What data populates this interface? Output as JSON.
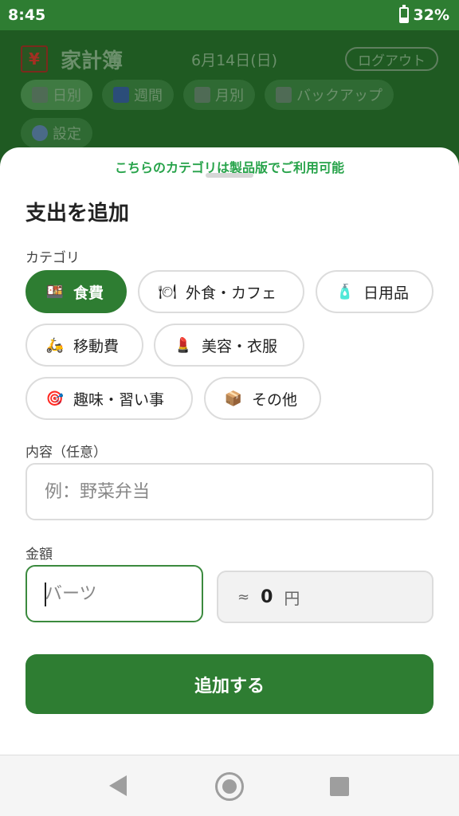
{
  "status": {
    "time": "8:45",
    "battery": "32%",
    "battery_level": 0.32
  },
  "header": {
    "icon_symbol": "¥",
    "title": "家計簿",
    "date": "6月14日(日)",
    "logout_label": "ログアウト",
    "nav": [
      {
        "label": "日別",
        "icon": "calendar-day-icon"
      },
      {
        "label": "週間",
        "icon": "calendar-week-icon"
      },
      {
        "label": "月別",
        "icon": "calendar-month-icon"
      },
      {
        "label": "バックアップ",
        "icon": "floppy-disk-icon"
      },
      {
        "label": "設定",
        "icon": "gear-icon"
      }
    ]
  },
  "sheet": {
    "promo": "こちらのカテゴリは製品版でご利用可能",
    "title": "支出を追加",
    "category_label": "カテゴリ",
    "categories": [
      {
        "label": "食費",
        "icon": "bento-icon",
        "glyph": "🍱"
      },
      {
        "label": "外食・カフェ",
        "icon": "plate-icon",
        "glyph": "🍽"
      },
      {
        "label": "日用品",
        "icon": "lotion-bottle-icon",
        "glyph": "🧴"
      },
      {
        "label": "移動費",
        "icon": "scooter-icon",
        "glyph": "🛵"
      },
      {
        "label": "美容・衣服",
        "icon": "lipstick-icon",
        "glyph": "💄"
      },
      {
        "label": "趣味・習い事",
        "icon": "target-icon",
        "glyph": "🎯"
      },
      {
        "label": "その他",
        "icon": "box-icon",
        "glyph": "📦"
      }
    ],
    "content_label": "内容（任意）",
    "content_placeholder": "例：野菜弁当",
    "amount_label": "金額",
    "amount_placeholder": "バーツ",
    "converted_prefix": "≈",
    "converted_value": "0",
    "converted_unit": "円",
    "submit_label": "追加する"
  },
  "colors": {
    "primary": "#2e7d32",
    "promo": "#27a34a",
    "overlay_header": "#1f5a22"
  }
}
